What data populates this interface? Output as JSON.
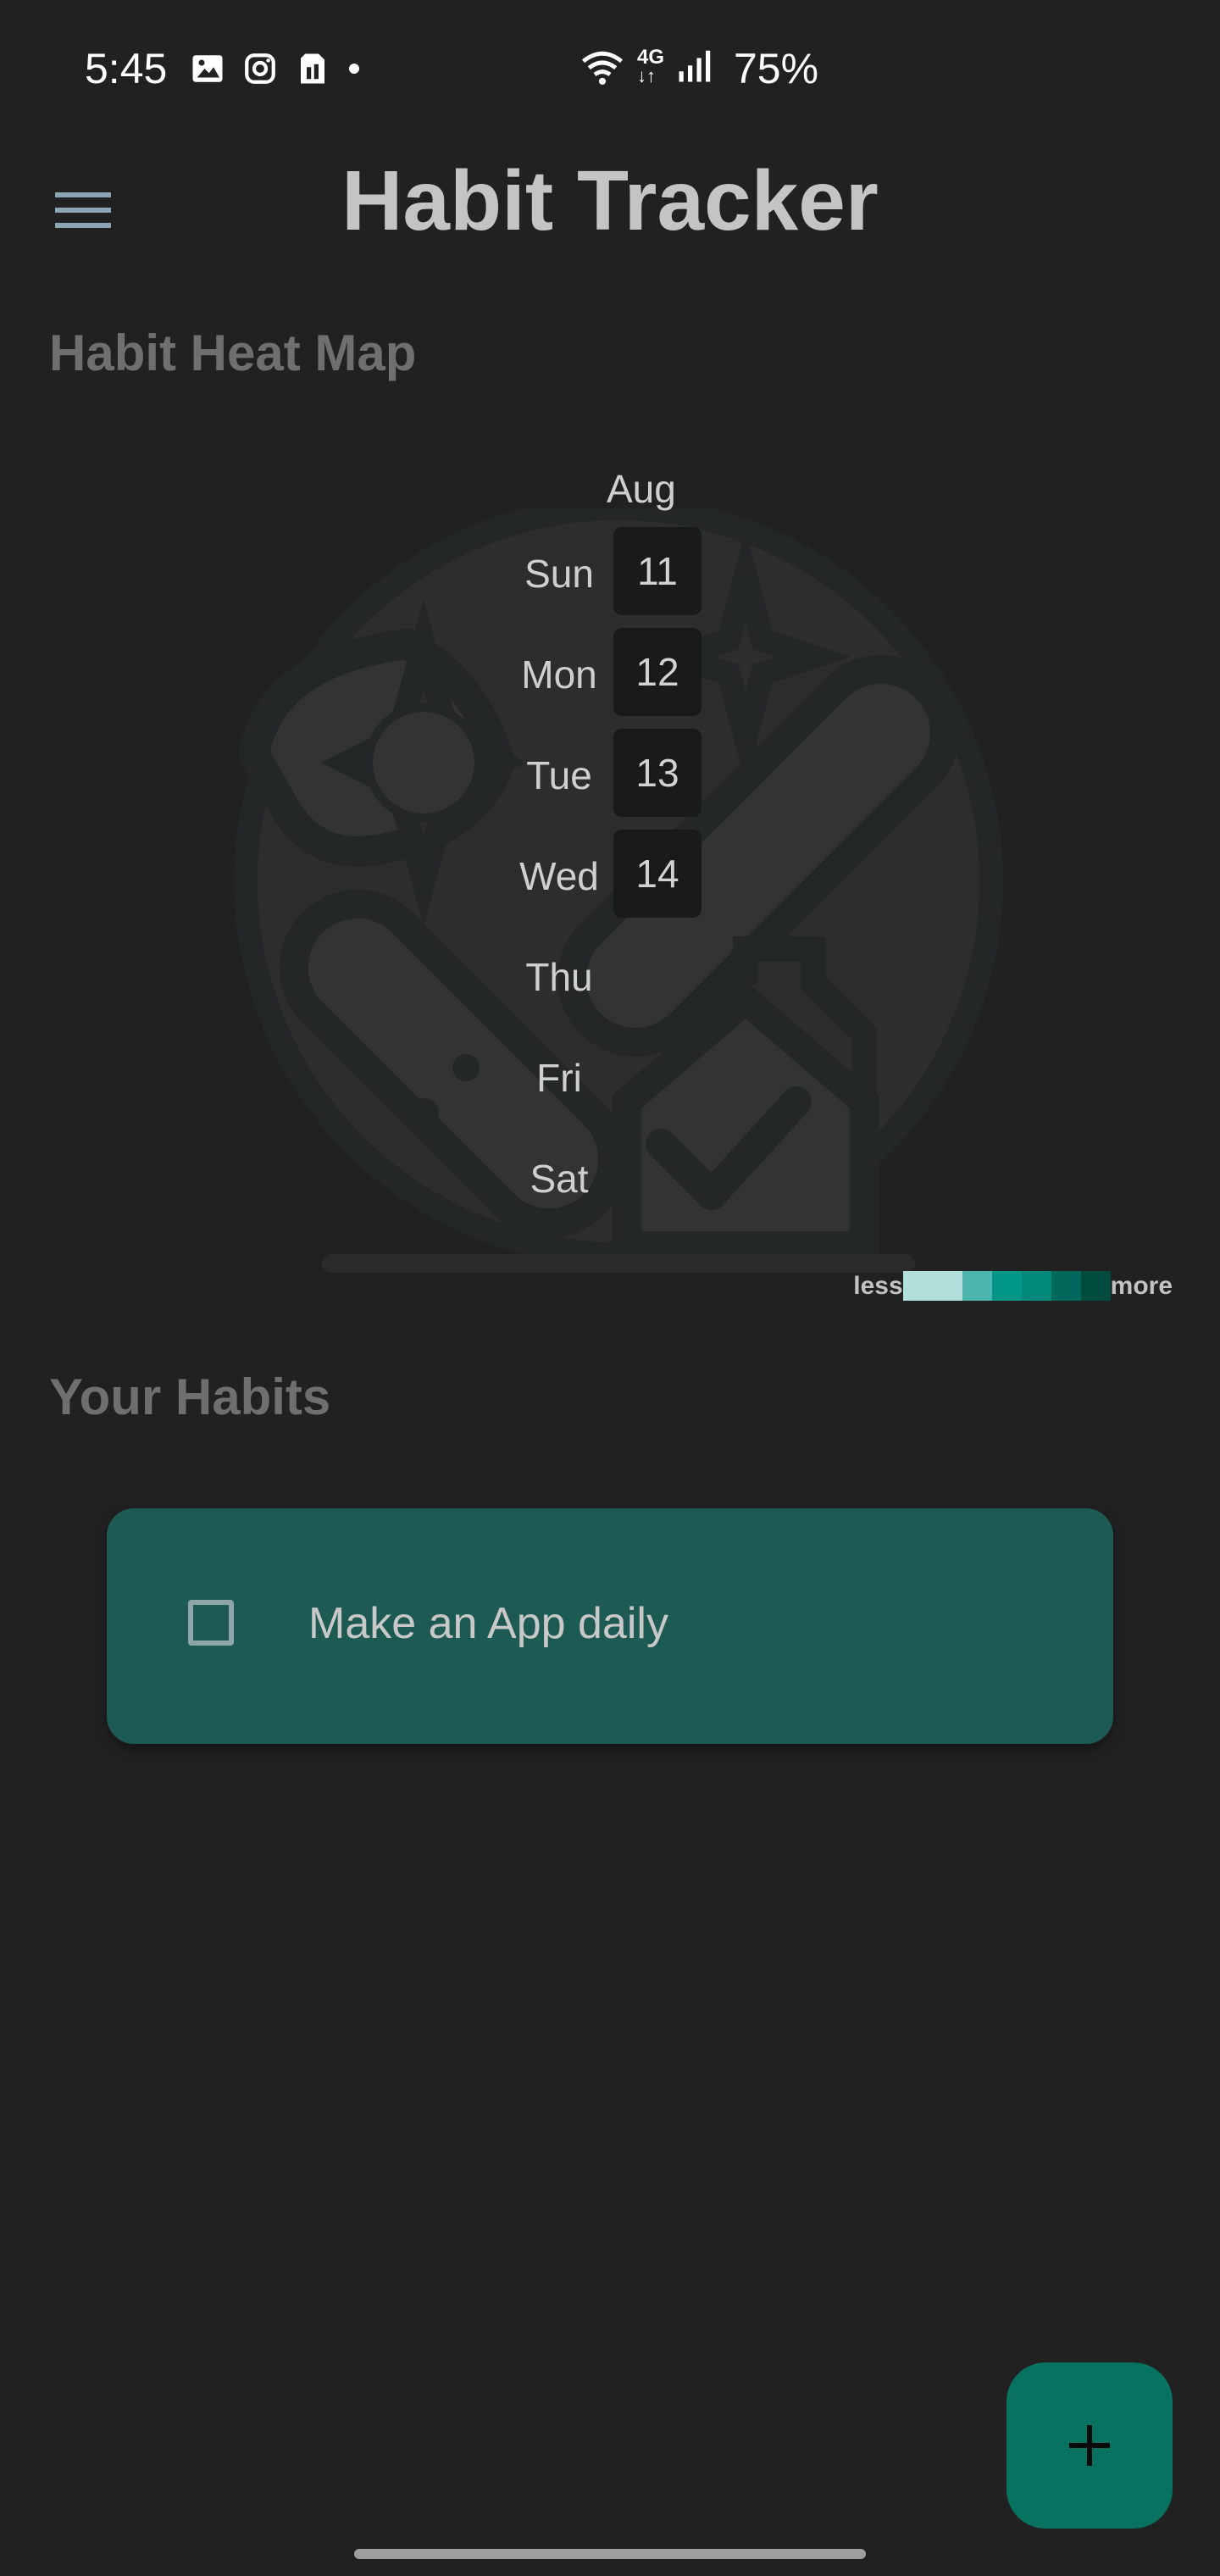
{
  "status_bar": {
    "time": "5:45",
    "battery": "75%",
    "network": "4G",
    "left_icons": [
      "image-icon",
      "instagram-icon",
      "sim-card-icon",
      "dot-icon"
    ],
    "right_icons": [
      "wifi-icon",
      "network-4g-icon",
      "signal-icon"
    ]
  },
  "app_bar": {
    "title": "Habit Tracker",
    "menu_icon": "menu-icon"
  },
  "heatmap": {
    "title": "Habit Heat Map",
    "month": "Aug",
    "days": [
      "Sun",
      "Mon",
      "Tue",
      "Wed",
      "Thu",
      "Fri",
      "Sat"
    ],
    "dates": [
      "11",
      "12",
      "13",
      "14"
    ],
    "legend_less": "less",
    "legend_more": "more",
    "legend_colors": [
      "#b2dfdb",
      "#4db6ac",
      "#009688",
      "#00897b",
      "#00695c",
      "#004d40"
    ]
  },
  "habits": {
    "title": "Your Habits",
    "items": [
      {
        "label": "Make an App daily",
        "checked": false
      }
    ]
  },
  "fab": {
    "icon": "plus-icon"
  },
  "colors": {
    "background": "#212121",
    "card": "#1e5a54",
    "fab": "#06725f"
  }
}
